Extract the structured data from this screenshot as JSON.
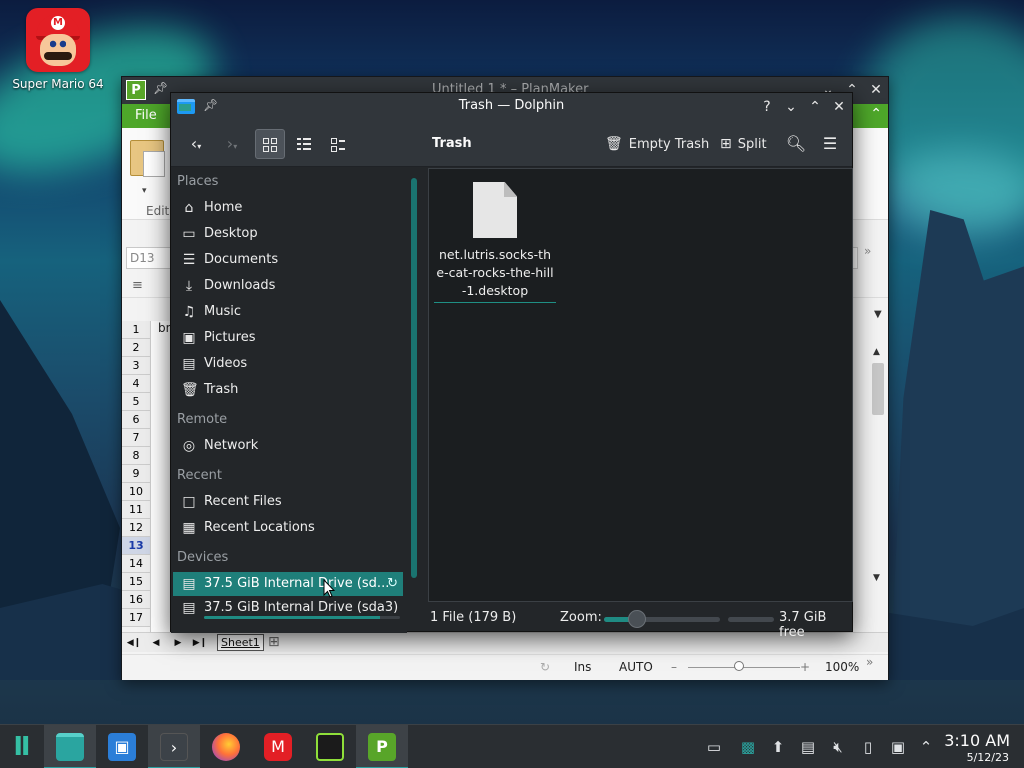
{
  "desktop": {
    "icon_label": "Super Mario 64"
  },
  "planmaker": {
    "title": "Untitled 1 * – PlanMaker",
    "file_tab": "File",
    "edit_label": "Edit",
    "cell_ref": "D13",
    "col_a_text": "bn",
    "rows": [
      "1",
      "2",
      "3",
      "4",
      "5",
      "6",
      "7",
      "8",
      "9",
      "10",
      "11",
      "12",
      "13",
      "14",
      "15",
      "16",
      "17"
    ],
    "selected_row": "13",
    "sheet_tab": "Sheet1",
    "status": {
      "ins": "Ins",
      "auto": "AUTO",
      "zoom": "100%",
      "minus": "–",
      "plus": "+"
    }
  },
  "dolphin": {
    "title": "Trash — Dolphin",
    "breadcrumb": "Trash",
    "toolbar": {
      "empty_trash": "Empty Trash",
      "split": "Split"
    },
    "places": {
      "sections": {
        "places": "Places",
        "remote": "Remote",
        "recent": "Recent",
        "devices": "Devices"
      },
      "items": [
        {
          "label": "Home",
          "icon": "home-icon"
        },
        {
          "label": "Desktop",
          "icon": "desktop-icon"
        },
        {
          "label": "Documents",
          "icon": "documents-icon"
        },
        {
          "label": "Downloads",
          "icon": "downloads-icon"
        },
        {
          "label": "Music",
          "icon": "music-icon"
        },
        {
          "label": "Pictures",
          "icon": "pictures-icon"
        },
        {
          "label": "Videos",
          "icon": "videos-icon"
        },
        {
          "label": "Trash",
          "icon": "trash-icon"
        }
      ],
      "remote": [
        {
          "label": "Network",
          "icon": "network-icon"
        }
      ],
      "recent": [
        {
          "label": "Recent Files",
          "icon": "recent-files-icon"
        },
        {
          "label": "Recent Locations",
          "icon": "recent-locations-icon"
        }
      ],
      "devices": [
        {
          "label": "37.5 GiB Internal Drive (sd...",
          "icon": "drive-icon",
          "active": true,
          "usage": 0.0
        },
        {
          "label": "37.5 GiB Internal Drive (sda3)",
          "icon": "drive-icon",
          "active": false,
          "usage": 0.9
        }
      ]
    },
    "file": {
      "name": "net.lutris.socks-the-cat-rocks-the-hill-1.desktop"
    },
    "status": {
      "count": "1 File (179 B)",
      "zoom_label": "Zoom:",
      "free": "3.7 GiB free",
      "zoom_level": 0.25
    }
  },
  "taskbar": {
    "clock_time": "3:10 AM",
    "clock_date": "5/12/23"
  },
  "colors": {
    "accent": "#1f8b83",
    "planmaker_green": "#4ea72a",
    "window_bg": "#232629",
    "titlebar": "#31363b"
  }
}
